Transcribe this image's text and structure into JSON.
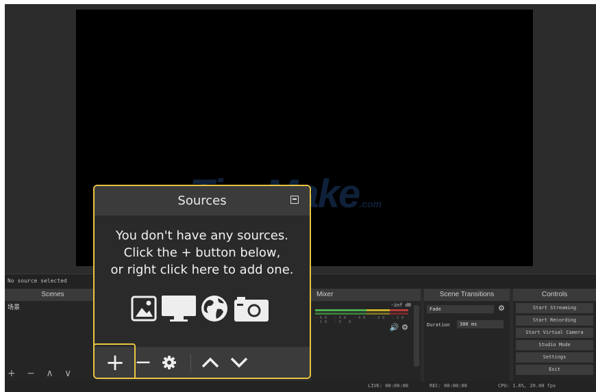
{
  "preview": {
    "background": "#000000"
  },
  "status": {
    "no_source": "No source selected"
  },
  "watermark": {
    "main": "TipsMake",
    "suffix": ".com"
  },
  "scenes": {
    "title": "Scenes",
    "items": [
      "场景"
    ],
    "toolbar": "+ − ∧ ∨"
  },
  "mixer": {
    "title": "Mixer",
    "db": "-inf dB",
    "ticks": "-60 -50 -40 -30 -20 -10 -5 0"
  },
  "transitions": {
    "title": "Scene Transitions",
    "type": "Fade",
    "duration_label": "Duration",
    "duration_value": "300 ms"
  },
  "controls": {
    "title": "Controls",
    "buttons": [
      "Start Streaming",
      "Start Recording",
      "Start Virtual Camera",
      "Studio Mode",
      "Settings",
      "Exit"
    ]
  },
  "statusbar": {
    "live": "LIVE: 00:00:00",
    "rec": "REC: 00:00:00",
    "cpu": "CPU: 1.6%, 20.00 fps"
  },
  "sources_popup": {
    "title": "Sources",
    "message_lines": [
      "You don't have any sources.",
      "Click the + button below,",
      "or right click here to add one."
    ],
    "icons": [
      "image-icon",
      "display-icon",
      "globe-icon",
      "camera-icon"
    ],
    "toolbar": {
      "add": "+",
      "remove": "−"
    }
  },
  "colors": {
    "highlight": "#e9c543",
    "app_bg": "#2c2c2c",
    "panel": "#3b3b3b"
  }
}
